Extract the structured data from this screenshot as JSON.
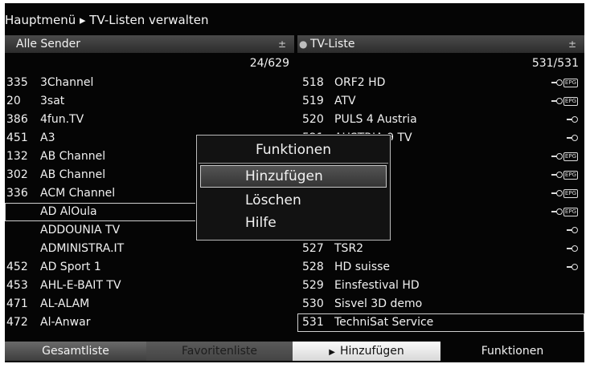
{
  "header": {
    "title": "Hauptmenü ▸ TV-Listen verwalten"
  },
  "left_panel": {
    "label": "Alle Sender",
    "sort_icon": "sort-icon",
    "counter": "24/629",
    "rows": [
      {
        "num": "335",
        "name": "3Channel"
      },
      {
        "num": "20",
        "name": "3sat"
      },
      {
        "num": "386",
        "name": "4fun.TV"
      },
      {
        "num": "451",
        "name": "A3"
      },
      {
        "num": "132",
        "name": "AB Channel"
      },
      {
        "num": "302",
        "name": "AB Channel"
      },
      {
        "num": "336",
        "name": "ACM Channel"
      },
      {
        "num": "",
        "name": "AD AlOula"
      },
      {
        "num": "",
        "name": "ADDOUNIA TV"
      },
      {
        "num": "",
        "name": "ADMINISTRA.IT"
      },
      {
        "num": "452",
        "name": "AD Sport 1"
      },
      {
        "num": "453",
        "name": "AHL-E-BAIT TV"
      },
      {
        "num": "471",
        "name": "AL-ALAM"
      },
      {
        "num": "472",
        "name": "Al-Anwar"
      }
    ]
  },
  "right_panel": {
    "label": "TV-Liste",
    "sort_icon": "sort-icon",
    "counter": "531/531",
    "rows": [
      {
        "num": "518",
        "name": "ORF2 HD",
        "icon": "key-epg"
      },
      {
        "num": "519",
        "name": "ATV",
        "icon": "key-epg"
      },
      {
        "num": "520",
        "name": "PULS 4 Austria",
        "icon": "key"
      },
      {
        "num": "521",
        "name": "AUSTRIA 9 TV",
        "icon": "key"
      },
      {
        "num": "",
        "name": "",
        "icon": "key-epg"
      },
      {
        "num": "",
        "name": "",
        "icon": "key-epg"
      },
      {
        "num": "",
        "name": "",
        "icon": "key-epg"
      },
      {
        "num": "",
        "name": "",
        "icon": "key-epg"
      },
      {
        "num": "",
        "name": "",
        "icon": "key"
      },
      {
        "num": "527",
        "name": "TSR2",
        "icon": "key"
      },
      {
        "num": "528",
        "name": "HD suisse",
        "icon": "key"
      },
      {
        "num": "529",
        "name": "Einsfestival HD",
        "icon": ""
      },
      {
        "num": "530",
        "name": "Sisvel 3D demo",
        "icon": ""
      },
      {
        "num": "531",
        "name": "TechniSat Service",
        "icon": ""
      }
    ]
  },
  "popup": {
    "title": "Funktionen",
    "items": [
      "Hinzufügen",
      "Löschen",
      "Hilfe"
    ]
  },
  "footer": {
    "red_label": "Gesamtliste",
    "green_label": "Favoritenliste",
    "yellow_label": "Hinzufügen",
    "blue_label": "Funktionen"
  },
  "colors": {
    "background": "#050505",
    "text": "#f1f1f1",
    "highlight": "#d8d8d8"
  }
}
